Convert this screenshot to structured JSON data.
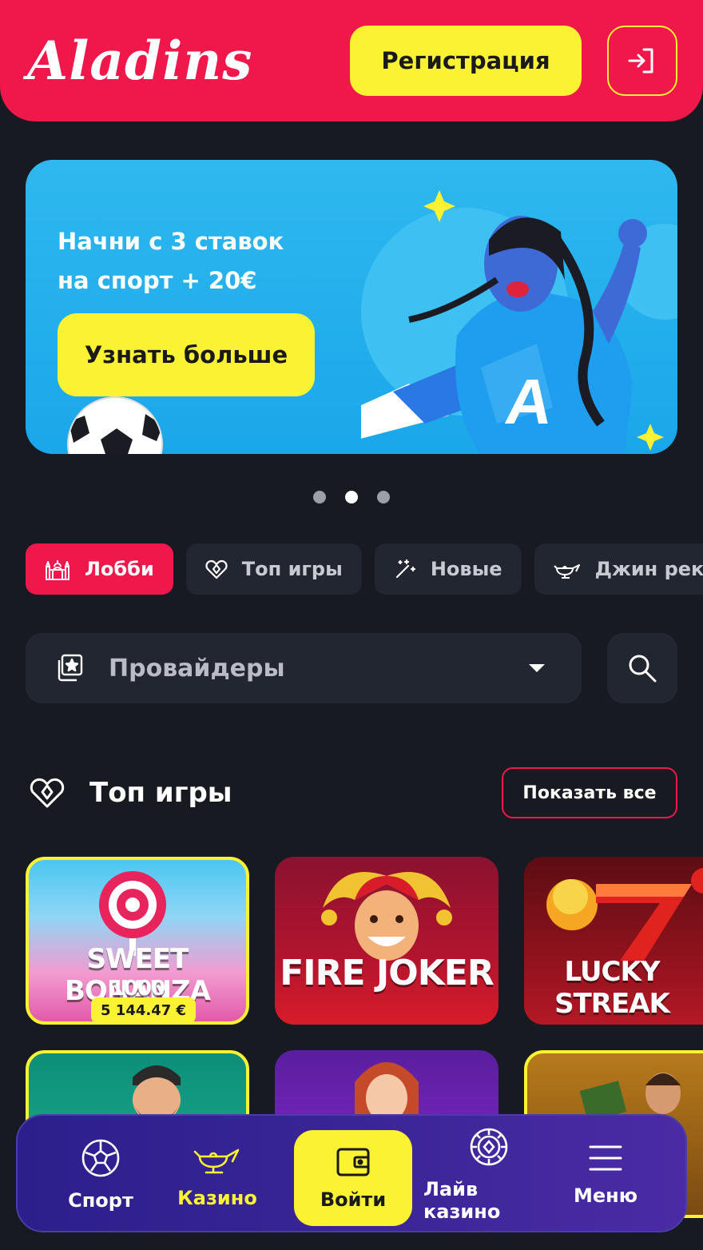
{
  "header": {
    "logo_text": "Aladins",
    "register_label": "Регистрация",
    "login_icon": "login-icon"
  },
  "banner": {
    "title_line1": "Начни с 3 ставок",
    "title_line2": "на спорт + 20€",
    "cta_label": "Узнать больше",
    "slide_count": 3,
    "active_slide": 2
  },
  "tabs": [
    {
      "label": "Лобби",
      "icon": "palace-icon",
      "active": true
    },
    {
      "label": "Топ игры",
      "icon": "heart-icon",
      "active": false
    },
    {
      "label": "Новые",
      "icon": "magic-wand-icon",
      "active": false
    },
    {
      "label": "Джин рекоменду",
      "icon": "lamp-icon",
      "active": false
    }
  ],
  "providers": {
    "label": "Провайдеры",
    "icon": "star-cards-icon"
  },
  "top_games": {
    "title": "Топ игры",
    "show_all_label": "Показать все",
    "games": [
      {
        "title_line1": "SWEET BONANZA",
        "title_line2": "1000",
        "jackpot": "5 144.47 €"
      },
      {
        "title_line1": "FIRE JOKER"
      },
      {
        "title_line1": "LUCKY STREAK"
      }
    ]
  },
  "bottom_nav": [
    {
      "label": "Спорт",
      "icon": "football-icon"
    },
    {
      "label": "Казино",
      "icon": "lamp-icon"
    },
    {
      "label": "Войти",
      "icon": "wallet-icon"
    },
    {
      "label": "Лайв казино",
      "icon": "chip-icon"
    },
    {
      "label": "Меню",
      "icon": "menu-icon"
    }
  ],
  "colors": {
    "brand_red": "#f0174a",
    "brand_yellow": "#fbf233",
    "background": "#171a21",
    "surface": "#222631",
    "nav_purple": "#3a2596"
  }
}
